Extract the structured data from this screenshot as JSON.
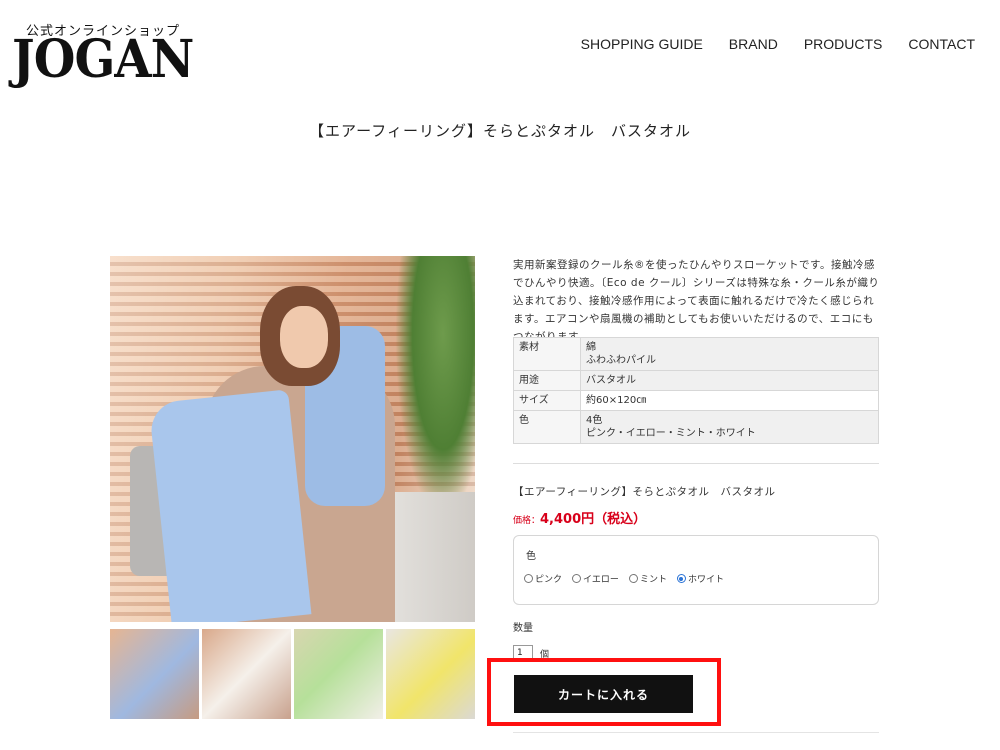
{
  "header": {
    "logo_sub": "公式オンラインショップ",
    "logo_main": "JOGAN",
    "nav": [
      "SHOPPING GUIDE",
      "BRAND",
      "PRODUCTS",
      "CONTACT"
    ]
  },
  "page_title": "【エアーフィーリング】そらとぷタオル　バスタオル",
  "description": "実用新案登録のクール糸®を使ったひんやりスローケットです。接触冷感でひんやり快適。〔Eco de クール〕シリーズは特殊な糸・クール糸が織り込まれており、接触冷感作用によって表面に触れるだけで冷たく感じられます。エアコンや扇風機の補助としてもお使いいただけるので、エコにもつながります。",
  "specs": [
    {
      "key": "素材",
      "lines": [
        "綿",
        "ふわふわパイル"
      ]
    },
    {
      "key": "用途",
      "lines": [
        "バスタオル"
      ]
    },
    {
      "key": "サイズ",
      "lines": [
        "約60×120㎝"
      ]
    },
    {
      "key": "色",
      "lines": [
        "4色",
        "ピンク・イエロー・ミント・ホワイト"
      ]
    }
  ],
  "product": {
    "name": "【エアーフィーリング】そらとぷタオル　バスタオル",
    "price_label": "価格：",
    "price_value": "4,400円（税込）"
  },
  "color_option": {
    "title": "色",
    "options": [
      "ピンク",
      "イエロー",
      "ミント",
      "ホワイト"
    ],
    "selected": "ホワイト"
  },
  "quantity": {
    "label": "数量",
    "value": "1",
    "unit": "個"
  },
  "cart_button": "カートに入れる",
  "colors": {
    "price": "#d8001a",
    "button": "#111111",
    "highlight": "#ff1010",
    "radio_selected": "#2a73d6"
  }
}
